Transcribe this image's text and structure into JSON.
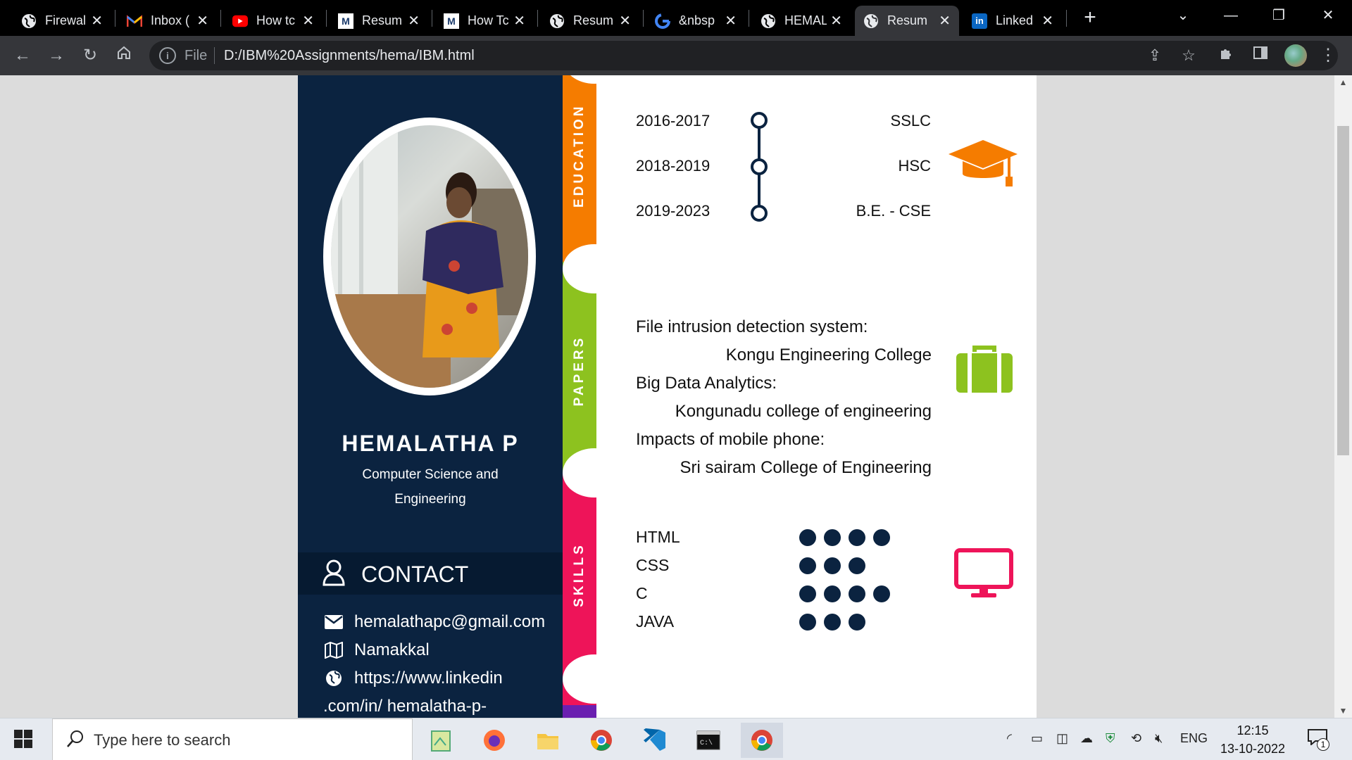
{
  "browser": {
    "tabs": [
      {
        "title": "Firewal",
        "icon": "globe-icon"
      },
      {
        "title": "Inbox (",
        "icon": "gmail-icon"
      },
      {
        "title": "How tc",
        "icon": "youtube-icon"
      },
      {
        "title": "Resum",
        "icon": "m-icon"
      },
      {
        "title": "How Tc",
        "icon": "m-icon"
      },
      {
        "title": "Resum",
        "icon": "globe-icon"
      },
      {
        "title": "&nbsp",
        "icon": "google-icon"
      },
      {
        "title": "HEMAL",
        "icon": "globe-icon"
      },
      {
        "title": "Resum",
        "icon": "globe-icon",
        "active": true
      },
      {
        "title": "Linked",
        "icon": "linkedin-icon"
      }
    ],
    "address": {
      "scheme_label": "File",
      "url": "D:/IBM%20Assignments/hema/IBM.html"
    }
  },
  "resume": {
    "name": "HEMALATHA P",
    "role": "Computer Science and Engineering",
    "contact": {
      "title": "CONTACT",
      "email": "hemalathapc@gmail.com",
      "location": "Namakkal",
      "linkedin_line1": "https://www.linkedin",
      "linkedin_line2": ".com/in/ hemalatha-p-"
    },
    "sections": {
      "education": "EDUCATION",
      "papers": "PAPERS",
      "skills": "SKILLS"
    },
    "education": [
      {
        "year": "2016-2017",
        "degree": "SSLC"
      },
      {
        "year": "2018-2019",
        "degree": "HSC"
      },
      {
        "year": "2019-2023",
        "degree": "B.E. - CSE"
      }
    ],
    "papers": [
      {
        "title": "File intrusion detection system:",
        "venue": "Kongu Engineering College"
      },
      {
        "title": "Big Data Analytics:",
        "venue": "Kongunadu college of engineering"
      },
      {
        "title": "Impacts of mobile phone:",
        "venue": "Sri sairam College of Engineering"
      }
    ],
    "skills": [
      {
        "name": "HTML",
        "level": 4
      },
      {
        "name": "CSS",
        "level": 3
      },
      {
        "name": "C",
        "level": 4
      },
      {
        "name": "JAVA",
        "level": 3
      }
    ],
    "colors": {
      "sidebar": "#0b2340",
      "education": "#f57c00",
      "papers": "#8dc21f",
      "skills": "#ee1459",
      "extra": "#6a1fb0"
    }
  },
  "taskbar": {
    "search_placeholder": "Type here to search",
    "language": "ENG",
    "time": "12:15",
    "date": "13-10-2022",
    "notification_count": "1"
  }
}
